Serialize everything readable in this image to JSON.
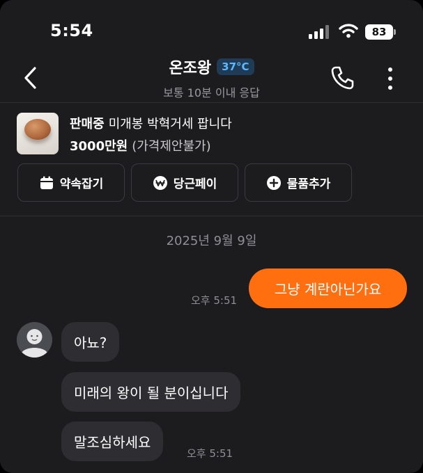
{
  "status_bar": {
    "time": "5:54",
    "battery": "83"
  },
  "header": {
    "title": "온조왕",
    "temperature": "37°C",
    "subtitle": "보통 10분 이내 응답"
  },
  "product": {
    "status": "판매중",
    "name": "미개봉 박혁거세 팝니다",
    "price": "3000만원",
    "price_note": "(가격제안불가)"
  },
  "actions": [
    {
      "label": "약속잡기",
      "icon": "calendar-icon"
    },
    {
      "label": "당근페이",
      "icon": "won-icon"
    },
    {
      "label": "물품추가",
      "icon": "plus-circle-icon"
    }
  ],
  "chat": {
    "date": "2025년 9월 9일",
    "messages": [
      {
        "from": "me",
        "text": "그냥 계란아닌가요",
        "time": "오후 5:51"
      },
      {
        "from": "other",
        "text": "아뇨?"
      },
      {
        "from": "other",
        "text": "미래의 왕이 될 분이십니다"
      },
      {
        "from": "other",
        "text": "말조심하세요",
        "time": "오후 5:51"
      }
    ]
  },
  "colors": {
    "background": "#1c1c1f",
    "accent_orange": "#ff6f0f",
    "temperature_blue": "#5db9ff",
    "bubble_gray": "#2d2d32"
  }
}
